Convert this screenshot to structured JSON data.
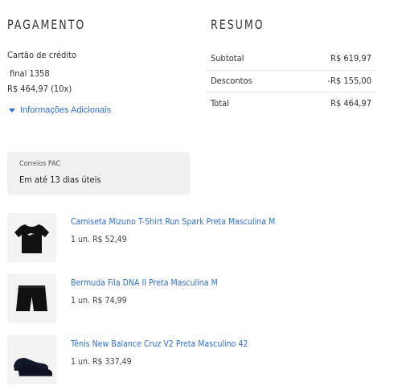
{
  "payment": {
    "title": "PAGAMENTO",
    "method": "Cartão de crédito",
    "card_ending": "final 1358",
    "installments": "R$ 464,97 (10x)",
    "more_info": "Informações Adicionais"
  },
  "summary": {
    "title": "RESUMO",
    "rows": [
      {
        "label": "Subtotal",
        "value": "R$ 619,97"
      },
      {
        "label": "Descontos",
        "value": "-R$ 155,00"
      },
      {
        "label": "Total",
        "value": "R$ 464,97"
      }
    ]
  },
  "shipping": {
    "carrier": "Correios PAC",
    "eta": "Em até 13 dias úteis"
  },
  "products": [
    {
      "name": "Camiseta Mizuno T-Shirt Run Spark Preta Masculina M",
      "price": "1 un. R$ 52,49",
      "icon": "tshirt-icon"
    },
    {
      "name": "Bermuda Fila DNA II Preta Masculina M",
      "price": "1 un. R$ 74,99",
      "icon": "shorts-icon"
    },
    {
      "name": "Tênis New Balance Cruz V2 Preta Masculino 42",
      "price": "1 un. R$ 337,49",
      "icon": "sneakers-icon"
    }
  ],
  "colors": {
    "link": "#2f6fd6",
    "box": "#f0f0f0"
  }
}
